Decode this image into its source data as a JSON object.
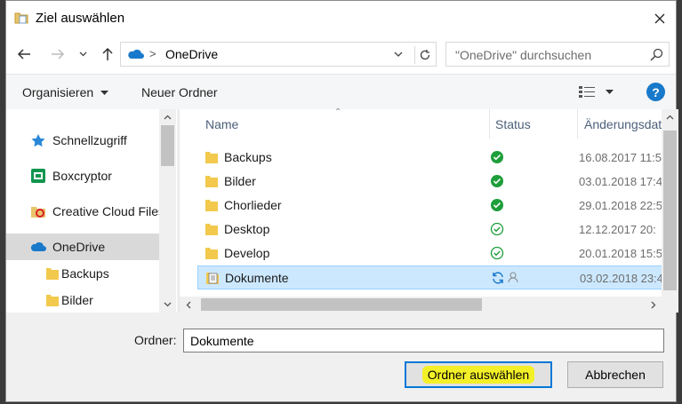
{
  "window": {
    "title": "Ziel auswählen"
  },
  "address": {
    "location": "OneDrive",
    "separator": ">"
  },
  "search": {
    "placeholder": "\"OneDrive\" durchsuchen"
  },
  "toolbar": {
    "organize_label": "Organisieren",
    "new_folder_label": "Neuer Ordner",
    "help_label": "?"
  },
  "nav": {
    "items": [
      {
        "label": "Schnellzugriff",
        "icon": "star-icon"
      },
      {
        "label": "Boxcryptor",
        "icon": "boxcryptor-icon"
      },
      {
        "label": "Creative Cloud Files",
        "icon": "creative-cloud-icon"
      },
      {
        "label": "OneDrive",
        "icon": "onedrive-icon",
        "selected": true
      },
      {
        "label": "Backups",
        "icon": "folder-icon"
      },
      {
        "label": "Bilder",
        "icon": "folder-icon"
      }
    ]
  },
  "columns": {
    "name": "Name",
    "status": "Status",
    "date": "Änderungsdatum"
  },
  "files": [
    {
      "name": "Backups",
      "status": "synced",
      "date": "16.08.2017 11:5"
    },
    {
      "name": "Bilder",
      "status": "synced",
      "date": "03.01.2018 17:4"
    },
    {
      "name": "Chorlieder",
      "status": "synced",
      "date": "29.01.2018 22:5"
    },
    {
      "name": "Desktop",
      "status": "available",
      "date": "12.12.2017 20:"
    },
    {
      "name": "Develop",
      "status": "available",
      "date": "20.01.2018 15:5"
    },
    {
      "name": "Dokumente",
      "status": "syncing",
      "date": "03.02.2018 23:4",
      "selected": true
    }
  ],
  "footer": {
    "folder_label": "Ordner:",
    "folder_value": "Dokumente",
    "select_button": "Ordner auswählen",
    "cancel_button": "Abbrechen"
  },
  "colors": {
    "accent": "#0078d7",
    "selection": "#cce8ff",
    "highlight": "#f4f028",
    "synced": "#1e9e3a"
  }
}
